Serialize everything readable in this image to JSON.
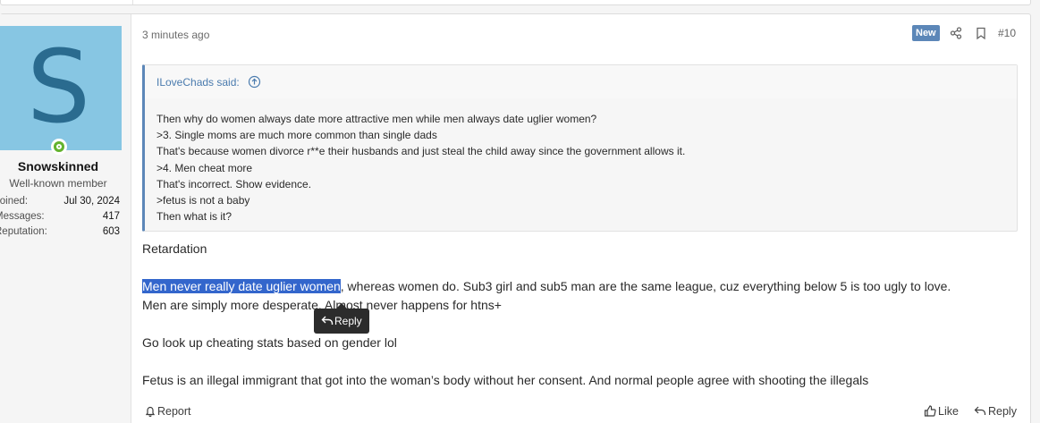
{
  "post": {
    "time": "3 minutes ago",
    "badge": "New",
    "number": "#10",
    "user": {
      "avatar_letter": "S",
      "name": "Snowskinned",
      "title": "Well-known member",
      "stats": [
        {
          "label": "Joined:",
          "value": "Jul 30, 2024"
        },
        {
          "label": "Messages:",
          "value": "417"
        },
        {
          "label": "Reputation:",
          "value": "603"
        }
      ]
    },
    "quote": {
      "author": "ILoveChads said:",
      "lines": [
        "Then why do women always date more attractive men while men always date uglier women?",
        ">3. Single moms are much more common than single dads",
        "That's because women divorce r**e their husbands and just steal the child away since the government allows it.",
        ">4. Men cheat more",
        "That's incorrect. Show evidence.",
        ">fetus is not a baby",
        "Then what is it?"
      ]
    },
    "body": {
      "line1": "Retardation",
      "line2_selected": "Men never really date uglier women",
      "line2_rest": ", whereas women do. Sub3 girl and sub5 man are the same league, cuz everything below 5 is too ugly to love.",
      "line3": "Men are simply more desperate. Almost never happens for htns+",
      "line4": "Go look up cheating stats based on gender lol",
      "line5": "Fetus is an illegal immigrant that got into the woman’s body without her consent. And normal people agree with shooting the illegals"
    },
    "reply_popup": "Reply",
    "footer": {
      "report": "Report",
      "like": "Like",
      "reply": "Reply"
    }
  }
}
